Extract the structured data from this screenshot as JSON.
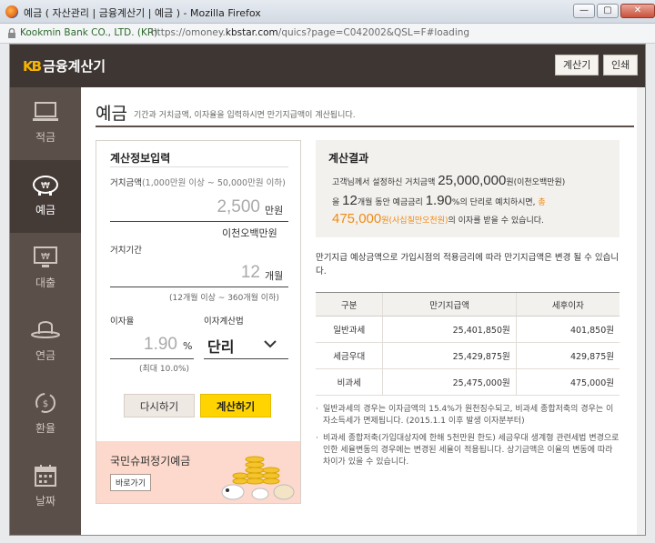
{
  "window": {
    "title": "예금 ( 자산관리 | 금융계산기 | 예금 ) - Mozilla Firefox",
    "minimize": "—",
    "maximize": "▢",
    "close": "✕"
  },
  "urlbar": {
    "site": "Kookmin Bank CO., LTD. (KR)",
    "url_prefix": "https://omoney.",
    "url_domain": "kbstar.com",
    "url_rest": "/quics?page=C042002&QSL=F#loading"
  },
  "header": {
    "logo_mark": "KB",
    "logo_text": "금융계산기",
    "calc_btn": "계산기",
    "print_btn": "인쇄"
  },
  "sidebar": {
    "items": [
      {
        "label": "적금",
        "icon": "laptop-icon"
      },
      {
        "label": "예금",
        "icon": "piggy-bank-icon"
      },
      {
        "label": "대출",
        "icon": "monitor-won-icon"
      },
      {
        "label": "연금",
        "icon": "hat-icon"
      },
      {
        "label": "환율",
        "icon": "exchange-icon"
      },
      {
        "label": "날짜",
        "icon": "calendar-icon"
      }
    ]
  },
  "page": {
    "title": "예금",
    "subtitle": "기간과 거치금액, 이자율을 입력하시면 만기지급액이 계산됩니다."
  },
  "form": {
    "title": "계산정보입력",
    "amount_label": "거치금액",
    "amount_hint": "(1,000만원 이상 ~ 50,000만원 이하)",
    "amount_value": "2,500",
    "amount_unit": "만원",
    "amount_korean": "이천오백만원",
    "period_label": "거치기간",
    "period_value": "12",
    "period_unit": "개월",
    "period_hint": "(12개월 이상 ~ 360개월 이하)",
    "rate_label": "이자율",
    "rate_value": "1.90",
    "rate_unit": "%",
    "rate_hint": "(최대 10.0%)",
    "method_label": "이자계산법",
    "method_value": "단리",
    "reset_btn": "다시하기",
    "calc_btn": "계산하기"
  },
  "banner": {
    "title": "국민슈퍼정기예금",
    "link": "바로가기"
  },
  "result": {
    "title": "계산결과",
    "line1_a": "고객님께서 설정하신 거치금액",
    "line1_amount": "25,000,000",
    "line1_b": "원(이천오백만원)",
    "line2_a": "을",
    "line2_months": "12",
    "line2_b": "개월 동안 예금금리",
    "line2_rate": "1.90",
    "line2_c": "%의 단리로 예치하시면,",
    "line2_d": "총",
    "line3_amount": "475,000",
    "line3_b": "원(사십칠만오천원)",
    "line3_c": "의 이자를 받을 수 있습니다.",
    "notice": "만기지급 예상금액으로 가입시점의 적용금리에 따라 만기지급액은 변경 될 수 있습니다."
  },
  "table": {
    "headers": [
      "구분",
      "만기지급액",
      "세후이자"
    ],
    "rows": [
      [
        "일반과세",
        "25,401,850원",
        "401,850원"
      ],
      [
        "세금우대",
        "25,429,875원",
        "429,875원"
      ],
      [
        "비과세",
        "25,475,000원",
        "475,000원"
      ]
    ]
  },
  "footnotes": [
    "일반과세의 경우는 이자금액의 15.4%가 원천징수되고, 비과세 종합저축의 경우는 이자소득세가 면제됩니다. (2015.1.1 이후 발생 이자분부터)",
    "비과세 종합저축(가입대상자에 한해 5천만원 한도) 세금우대 생계형 관련세법 변경으로 인한 세율변동의 경우에는 변경된 세율이 적용됩니다. 상기금액은 이율의 변동에 따라 차이가 있을 수 있습니다."
  ],
  "colors": {
    "header_bg": "#3d3633",
    "sidebar_bg": "#5b4f49",
    "accent_yellow": "#ffd400",
    "accent_orange": "#f08b12"
  }
}
